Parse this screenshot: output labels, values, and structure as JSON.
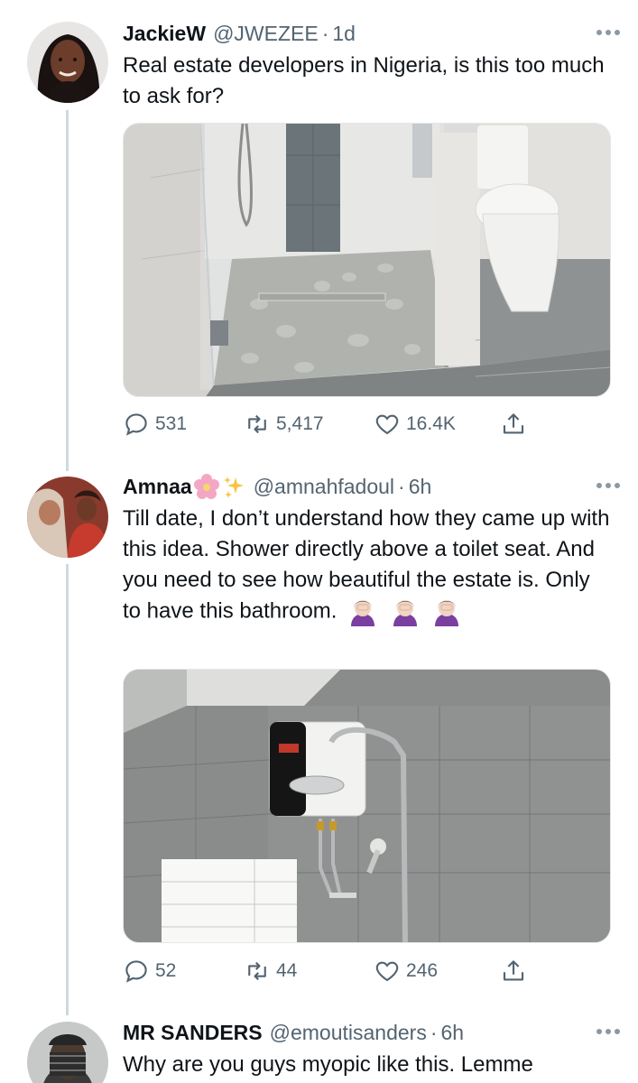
{
  "tweets": [
    {
      "name": "JackieW",
      "handle": "@JWEZEE",
      "separator": "·",
      "time": "1d",
      "text": "Real estate developers in Nigeria, is this too much to ask for?",
      "avatar": "woman-portrait",
      "media": "bathroom-glass-shower-toilet-photo",
      "stats": {
        "replies": "531",
        "retweets": "5,417",
        "likes": "16.4K"
      }
    },
    {
      "name": "Amnaa",
      "name_emojis": [
        "cherry-blossom",
        "sparkles"
      ],
      "handle": "@amnahfadoul",
      "separator": "·",
      "time": "6h",
      "text": "Till date, I don’t understand how they came up with this idea. Shower directly above a toilet seat. And you need to see how beautiful the estate is. Only to have this bathroom.",
      "trailing_emojis": [
        "woman-facepalming",
        "woman-facepalming",
        "woman-facepalming"
      ],
      "avatar": "two-women-photo",
      "media": "water-heater-shower-photo",
      "stats": {
        "replies": "52",
        "retweets": "44",
        "likes": "246"
      }
    },
    {
      "name": "MR SANDERS",
      "handle": "@emoutisanders",
      "separator": "·",
      "time": "6h",
      "text": "Why are you guys myopic like this. Lemme",
      "avatar": "masked-man-photo"
    }
  ],
  "icons": {
    "reply": "reply-icon",
    "retweet": "retweet-icon",
    "like": "heart-icon",
    "share": "share-icon",
    "more": "more-icon"
  },
  "colors": {
    "text": "#0f1419",
    "secondary": "#536471",
    "thread_line": "#cfd9de"
  }
}
